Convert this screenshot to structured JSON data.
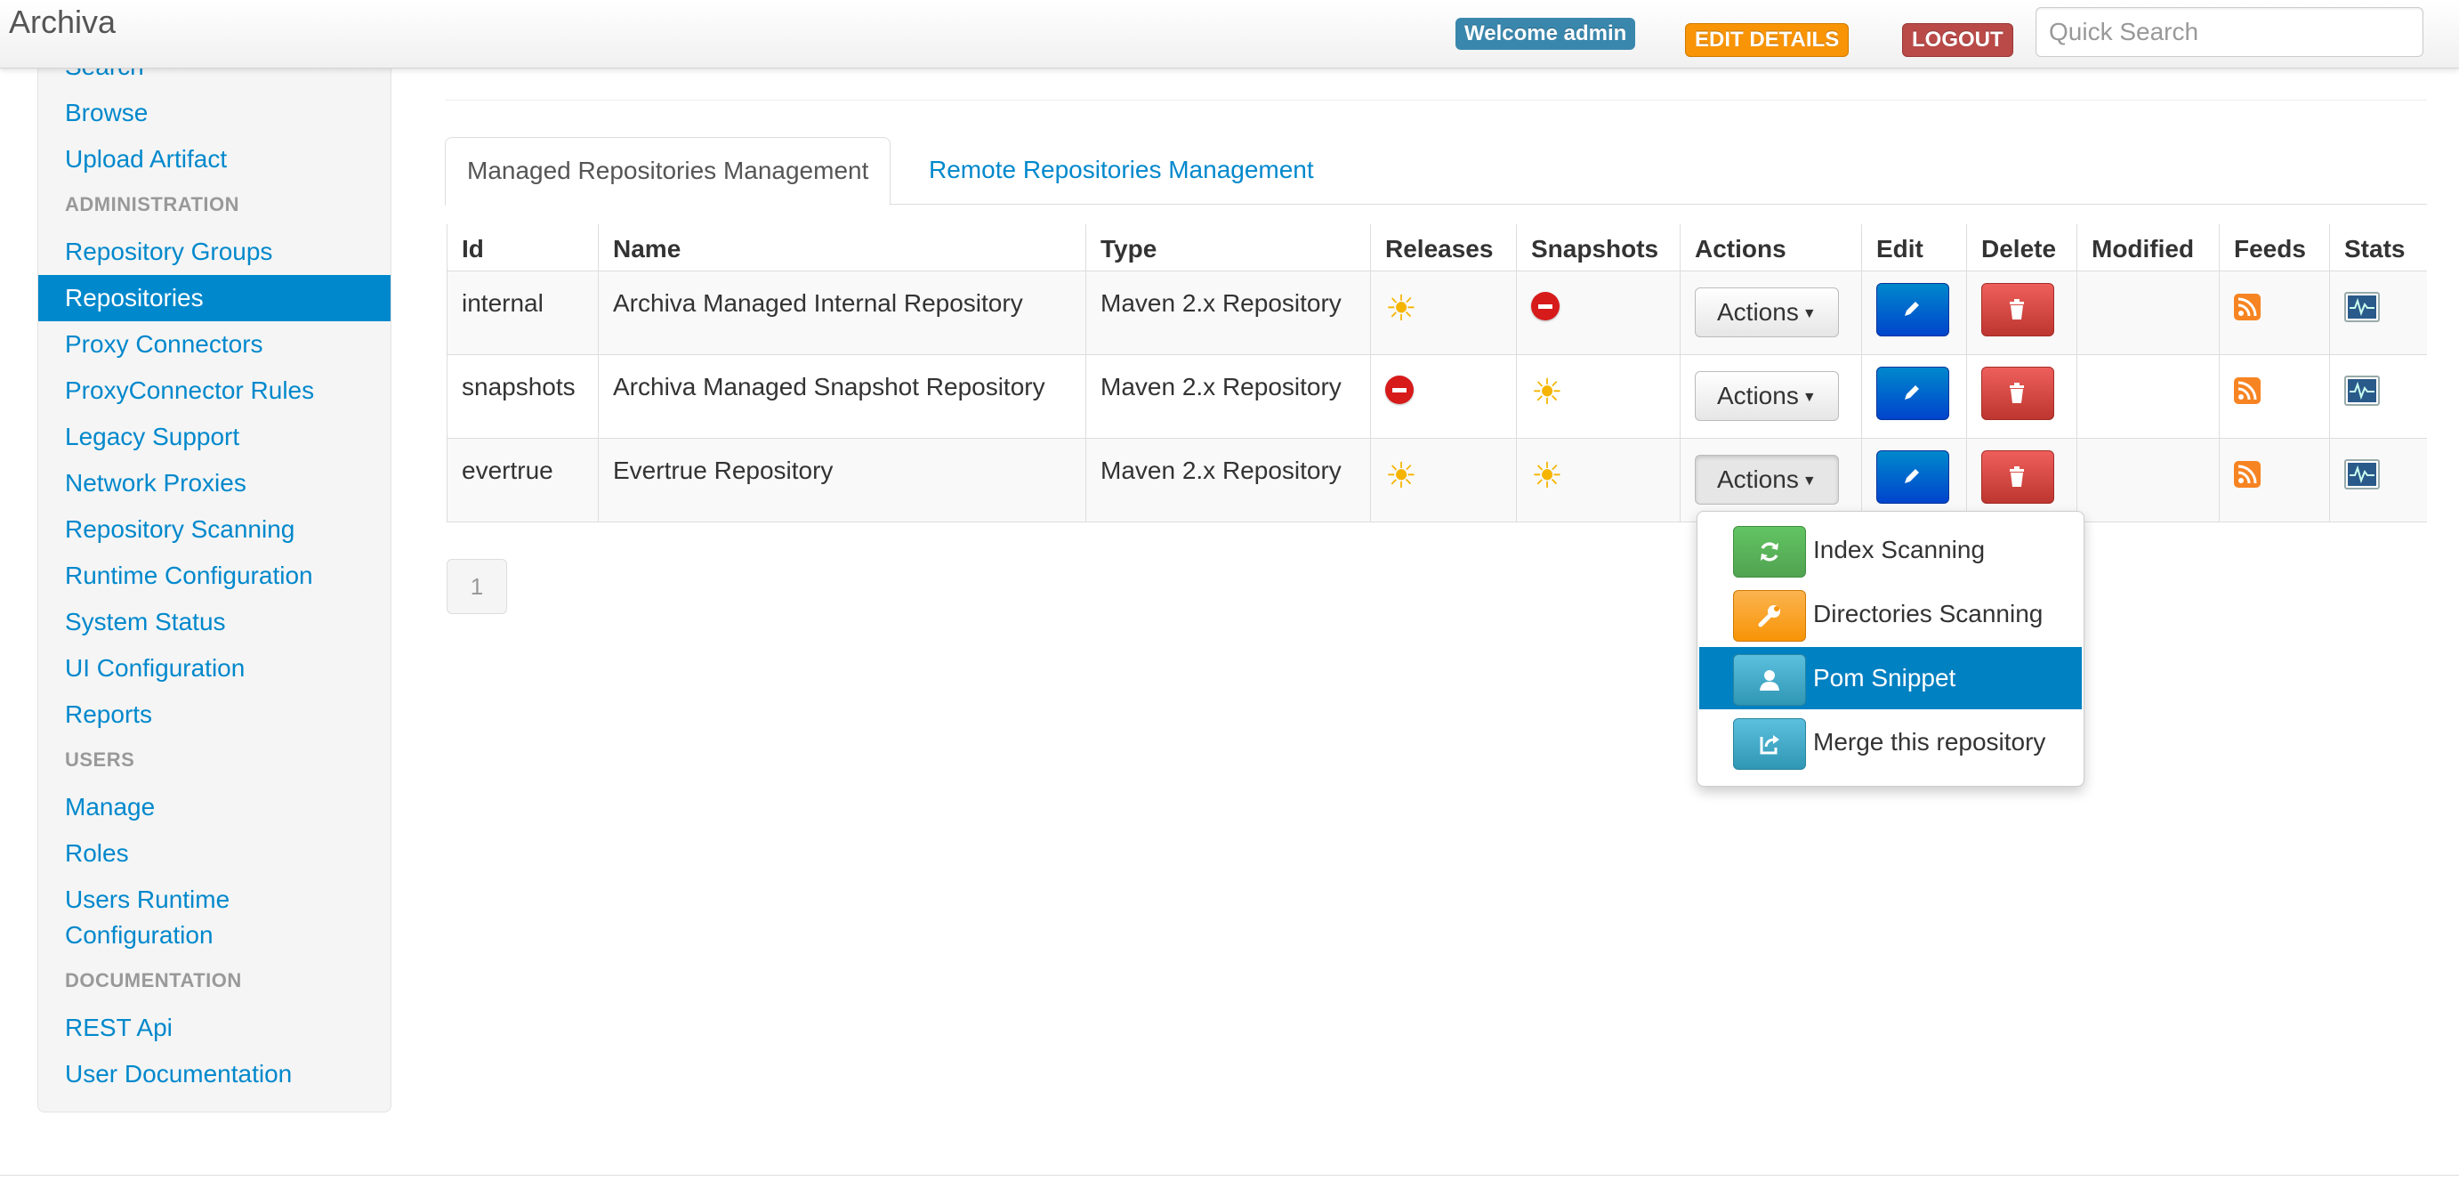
{
  "app": {
    "brand": "Archiva"
  },
  "header": {
    "welcome": "Welcome admin",
    "edit_details": "EDIT DETAILS",
    "logout": "LOGOUT",
    "search_placeholder": "Quick Search"
  },
  "sidebar": {
    "items": [
      {
        "label": "Search"
      },
      {
        "label": "Browse"
      },
      {
        "label": "Upload Artifact"
      }
    ],
    "admin_header": "ADMINISTRATION",
    "admin_items": [
      {
        "label": "Repository Groups"
      },
      {
        "label": "Repositories"
      },
      {
        "label": "Proxy Connectors"
      },
      {
        "label": "ProxyConnector Rules"
      },
      {
        "label": "Legacy Support"
      },
      {
        "label": "Network Proxies"
      },
      {
        "label": "Repository Scanning"
      },
      {
        "label": "Runtime Configuration"
      },
      {
        "label": "System Status"
      },
      {
        "label": "UI Configuration"
      },
      {
        "label": "Reports"
      }
    ],
    "users_header": "USERS",
    "users_items": [
      {
        "label": "Manage"
      },
      {
        "label": "Roles"
      },
      {
        "label": "Users Runtime Configuration"
      }
    ],
    "docs_header": "DOCUMENTATION",
    "docs_items": [
      {
        "label": "REST Api"
      },
      {
        "label": "User Documentation"
      }
    ]
  },
  "tabs": [
    {
      "label": "Managed Repositories Management"
    },
    {
      "label": "Remote Repositories Management"
    }
  ],
  "table": {
    "columns": [
      "Id",
      "Name",
      "Type",
      "Releases",
      "Snapshots",
      "Actions",
      "Edit",
      "Delete",
      "Modified",
      "Feeds",
      "Stats"
    ],
    "rows": [
      {
        "id": "internal",
        "name": "Archiva Managed Internal Repository",
        "type": "Maven 2.x Repository",
        "releases": "sun-icon",
        "snapshots": "no-entry-icon",
        "actions": "Actions"
      },
      {
        "id": "snapshots",
        "name": "Archiva Managed Snapshot Repository",
        "type": "Maven 2.x Repository",
        "releases": "no-entry-icon",
        "snapshots": "sun-icon",
        "actions": "Actions"
      },
      {
        "id": "evertrue",
        "name": "Evertrue Repository",
        "type": "Maven 2.x Repository",
        "releases": "sun-icon",
        "snapshots": "sun-icon",
        "actions": "Actions"
      }
    ]
  },
  "dropdown": {
    "items": [
      {
        "label": "Index Scanning",
        "icon": "refresh-icon"
      },
      {
        "label": "Directories Scanning",
        "icon": "wrench-icon"
      },
      {
        "label": "Pom Snippet",
        "icon": "user-icon"
      },
      {
        "label": "Merge this repository",
        "icon": "share-icon"
      }
    ]
  },
  "pagination": {
    "current": "1"
  },
  "colors": {
    "link": "#0088cc",
    "welcome": "#3a87ad",
    "warning": "#f89406",
    "danger": "#b94a48",
    "primary": "#0044cc",
    "success": "#51a351",
    "info": "#2f96b4"
  }
}
